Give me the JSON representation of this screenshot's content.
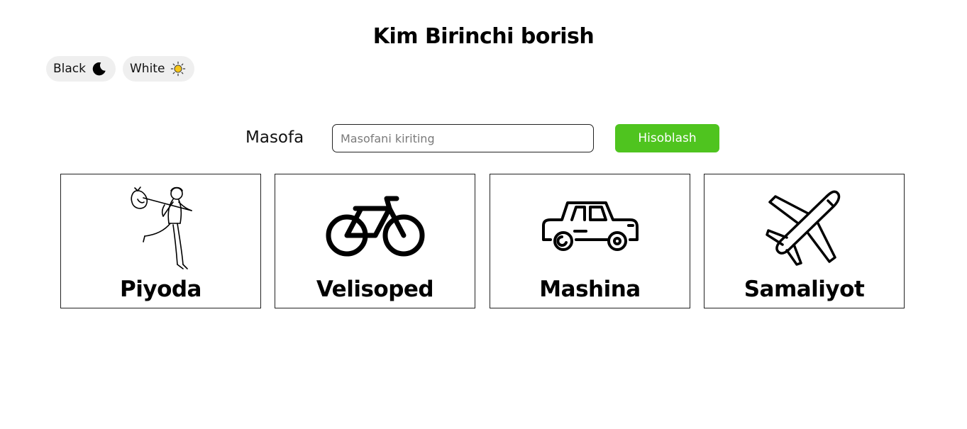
{
  "header": {
    "title": "Kim Birinchi borish"
  },
  "theme": {
    "black": {
      "label": "Black",
      "icon": "moon-icon"
    },
    "white": {
      "label": "White",
      "icon": "sun-icon",
      "icon_color": "#f5c518"
    }
  },
  "form": {
    "label": "Masofa",
    "input_placeholder": "Masofani kiriting",
    "input_value": "",
    "button_label": "Hisoblash",
    "button_color": "#4fc41f"
  },
  "transports": [
    {
      "label": "Piyoda",
      "icon": "walking-man-icon"
    },
    {
      "label": "Velisoped",
      "icon": "bicycle-icon"
    },
    {
      "label": "Mashina",
      "icon": "car-icon"
    },
    {
      "label": "Samaliyot",
      "icon": "airplane-icon"
    }
  ]
}
